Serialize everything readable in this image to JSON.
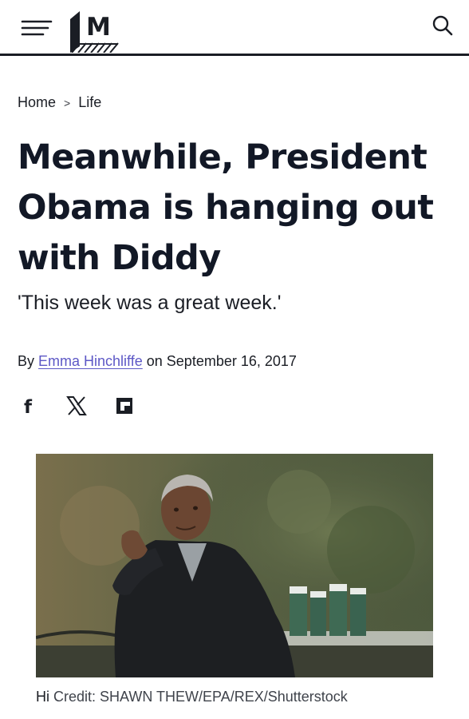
{
  "header": {
    "menu_icon": "hamburger-menu-icon",
    "logo_icon": "mashable-logo",
    "logo_letter": "M",
    "search_icon": "search-icon"
  },
  "breadcrumb": {
    "home": "Home",
    "separator": ">",
    "section": "Life"
  },
  "article": {
    "title": "Meanwhile, President Obama is hanging out with Diddy",
    "subtitle": "'This week was a great week.'",
    "byline_prefix": "By",
    "author": "Emma Hinchliffe",
    "date_text": "on September 16, 2017"
  },
  "share": {
    "facebook": "f",
    "x_icon": "x-icon",
    "flipboard_icon": "flipboard-icon"
  },
  "image": {
    "caption_prefix": "Hi",
    "credit": "Credit: SHAWN THEW/EPA/REX/Shutterstock"
  },
  "colors": {
    "text": "#121826",
    "link": "#5d58c6",
    "rule": "#1a1d24"
  }
}
